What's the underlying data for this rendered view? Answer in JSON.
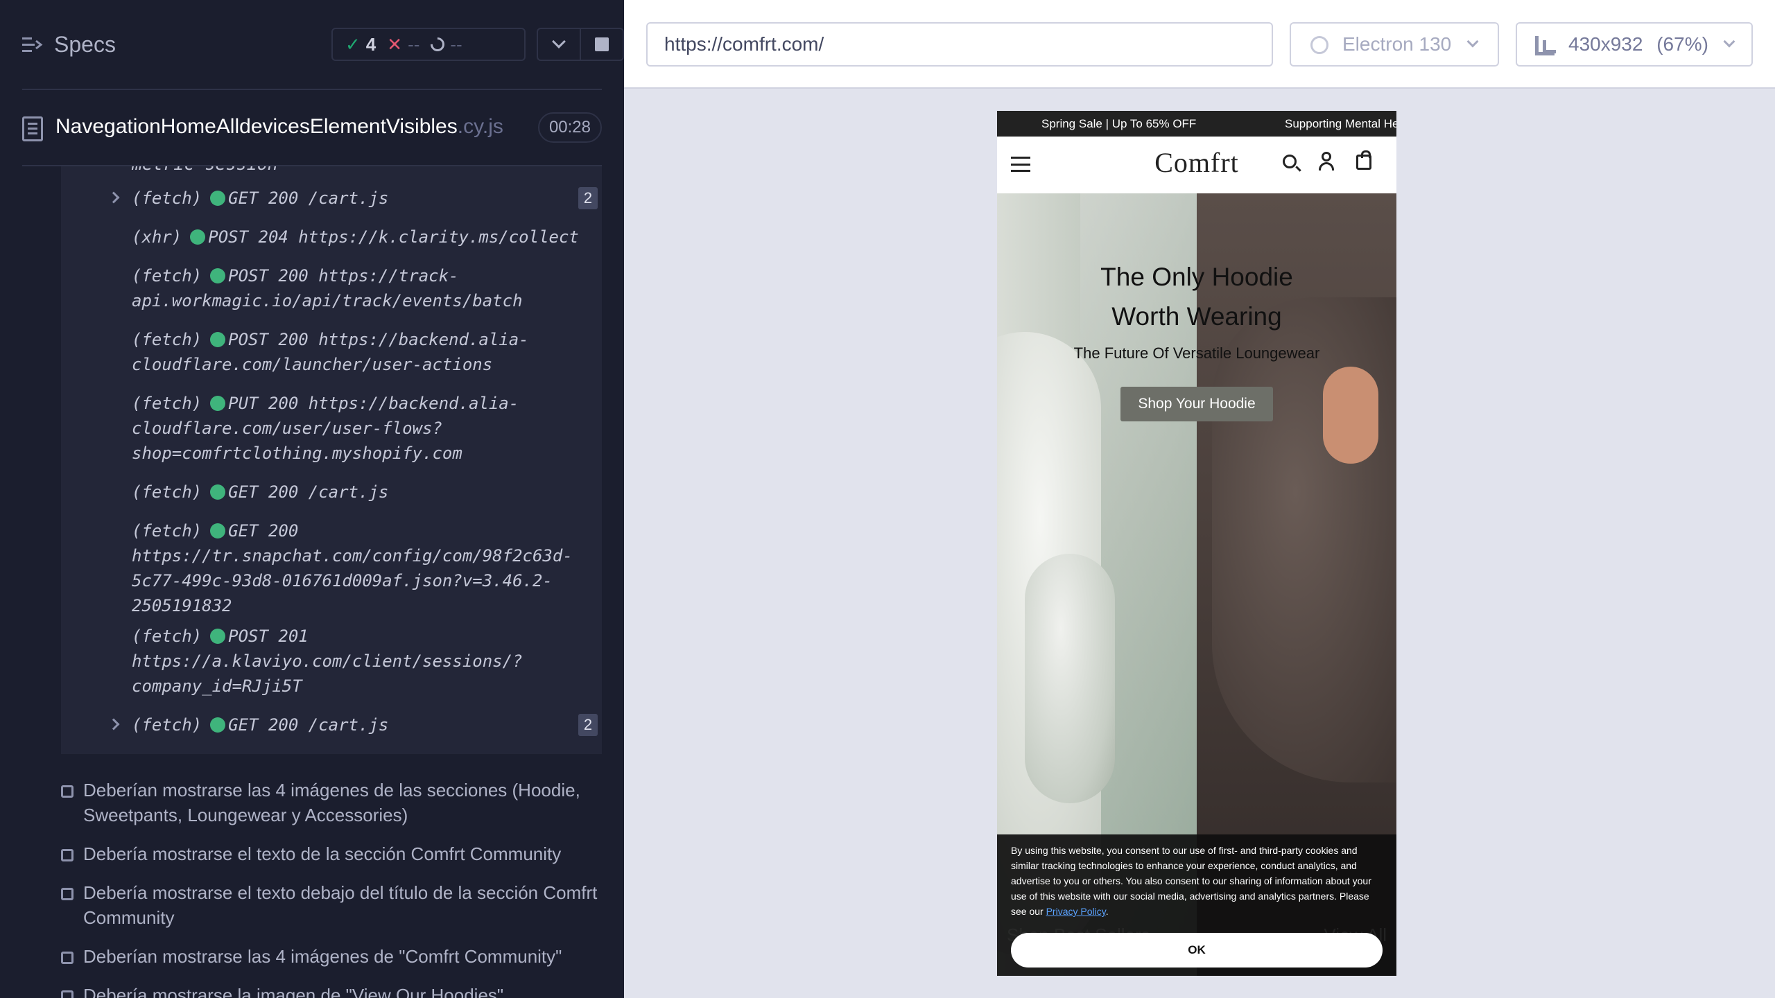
{
  "left_panel": {
    "title": "Specs",
    "stats": {
      "passed": "4",
      "failed": "--",
      "pending": "--"
    },
    "file": {
      "name": "NavegationHomeAlldevicesElementVisibles",
      "ext": ".cy.js",
      "duration": "00:28"
    },
    "cut_text": "metric session",
    "log": [
      {
        "type": "(fetch)",
        "text": "GET 200 /cart.js",
        "badge": "2",
        "expandable": true
      },
      {
        "type": "(xhr)",
        "text": "POST 204 https://k.clarity.ms/collect",
        "badge": "",
        "expandable": false
      },
      {
        "type": "(fetch)",
        "text": "POST 200 https://track-",
        "cont": [
          "api.workmagic.io/api/track/events/batch"
        ],
        "badge": "",
        "expandable": false
      },
      {
        "type": "(fetch)",
        "text": "POST 200 https://backend.alia-",
        "cont": [
          "cloudflare.com/launcher/user-actions"
        ],
        "badge": "",
        "expandable": false
      },
      {
        "type": "(fetch)",
        "text": "PUT 200 https://backend.alia-",
        "cont": [
          "cloudflare.com/user/user-flows?",
          "shop=comfrtclothing.myshopify.com"
        ],
        "badge": "",
        "expandable": false
      },
      {
        "type": "(fetch)",
        "text": "GET 200 /cart.js",
        "badge": "",
        "expandable": false
      },
      {
        "type": "(fetch)",
        "text": "GET 200",
        "cont": [
          "https://tr.snapchat.com/config/com/98f2c63d-",
          "5c77-499c-93d8-016761d009af.json?v=3.46.2-",
          "2505191832"
        ],
        "badge": "",
        "expandable": false
      },
      {
        "type": "(fetch)",
        "text": "POST 201",
        "cont": [
          "https://a.klaviyo.com/client/sessions/?",
          "company_id=RJji5T"
        ],
        "badge": "",
        "expandable": false
      },
      {
        "type": "(fetch)",
        "text": "GET 200 /cart.js",
        "badge": "2",
        "expandable": true
      }
    ],
    "tests": [
      "Deberían mostrarse las 4 imágenes de las secciones (Hoodie, Sweetpants, Loungewear y Accessories)",
      "Debería mostrarse el texto de la sección Comfrt Community",
      "Debería mostrarse el texto debajo del título de la sección Comfrt Community",
      "Deberían mostrarse las 4 imágenes de \"Comfrt Community\"",
      "Debería mostrarse la imagen de \"View Our Hoodies\""
    ]
  },
  "topbar": {
    "url": "https://comfrt.com/",
    "browser": "Electron 130",
    "viewport": "430x932",
    "zoom": "(67%)"
  },
  "site": {
    "announcement_1": "Spring Sale | Up To 65% OFF",
    "announcement_2": "Supporting Mental He",
    "logo": "Comfrt",
    "hero_title_1": "The Only Hoodie",
    "hero_title_2": "Worth Wearing",
    "hero_sub": "The Future Of Versatile Loungewear",
    "hero_button": "Shop Your Hoodie",
    "cookie_text": "By using this website, you consent to our use of first- and third-party cookies and similar tracking technologies to enhance your experience, conduct analytics, and advertise to you or others. You also consent to our sharing of information about your use of this website with our social media, advertising and analytics partners. Please see our",
    "cookie_link": "Privacy Policy",
    "cookie_end": ".",
    "peek_left": "Shop Best Sellers",
    "peek_right": "View All",
    "cookie_ok": "OK"
  }
}
